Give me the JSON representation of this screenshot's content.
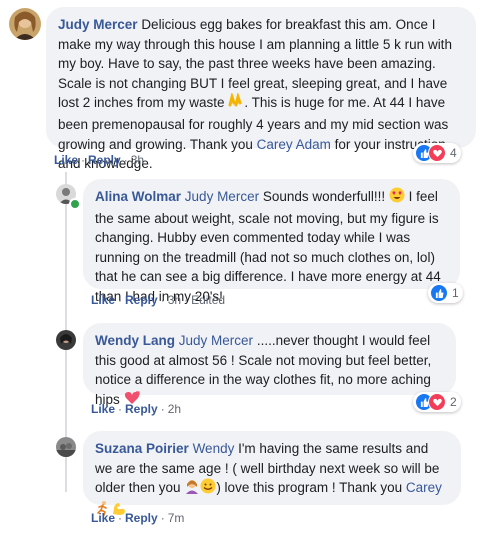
{
  "comments": [
    {
      "author": "Judy Mercer",
      "text_before": "Delicious egg bakes for breakfast this am. Once I make my way through this house I am planning a little 5 k run with my boy. Have to say, the past three weeks have been amazing. Scale is not changing BUT I feel great, sleeping great, and I have lost 2 inches from my waste ",
      "text_after": ". This is huge for me. At 44 I have been premenopausal for roughly 4 years and my mid section was growing and growing. Thank you ",
      "mention": "Carey Adam",
      "text_end": " for your instruction and knowledge.",
      "like_label": "Like",
      "reply_label": "Reply",
      "time": "3h",
      "reaction_count": "4",
      "emoji_icon": "raised-hands-icon"
    },
    {
      "author": "Alina Wolmar",
      "mention": "Judy Mercer",
      "text_before": " Sounds wonderfull!!! ",
      "text_after": " I feel the same about weight, scale not moving, but my figure is changing. Hubby even commented today while I was running on the treadmill (had not so much clothes on, lol) that he can see a big difference. I have more energy at 44 than I had in my 20's!",
      "like_label": "Like",
      "reply_label": "Reply",
      "time": "3h",
      "edited": "Edited",
      "reaction_count": "1",
      "emoji_icon": "heart-eyes-icon"
    },
    {
      "author": "Wendy Lang",
      "mention": "Judy Mercer",
      "text_before": " .....never thought I would feel this good at almost 56 ! Scale not moving but feel better, notice a difference in the way clothes fit, no more aching hips ",
      "like_label": "Like",
      "reply_label": "Reply",
      "time": "2h",
      "reaction_count": "2",
      "emoji_icon": "growing-heart-icon"
    },
    {
      "author": "Suzana Poirier",
      "mention": "Wendy",
      "text_before": " I'm having the same results and we are the same age ! ( well birthday next week so will be older then you ",
      "text_after": ") love this program ! Thank you ",
      "mention2": "Carey",
      "like_label": "Like",
      "reply_label": "Reply",
      "time": "7m",
      "emoji_icons": [
        "woman-gesturing-icon",
        "smile-icon",
        "runner-icon",
        "flexed-biceps-icon"
      ]
    }
  ],
  "colors": {
    "link": "#385898",
    "bubble": "#f0f2f5",
    "like": "#1877f2",
    "love": "#f33e58"
  }
}
